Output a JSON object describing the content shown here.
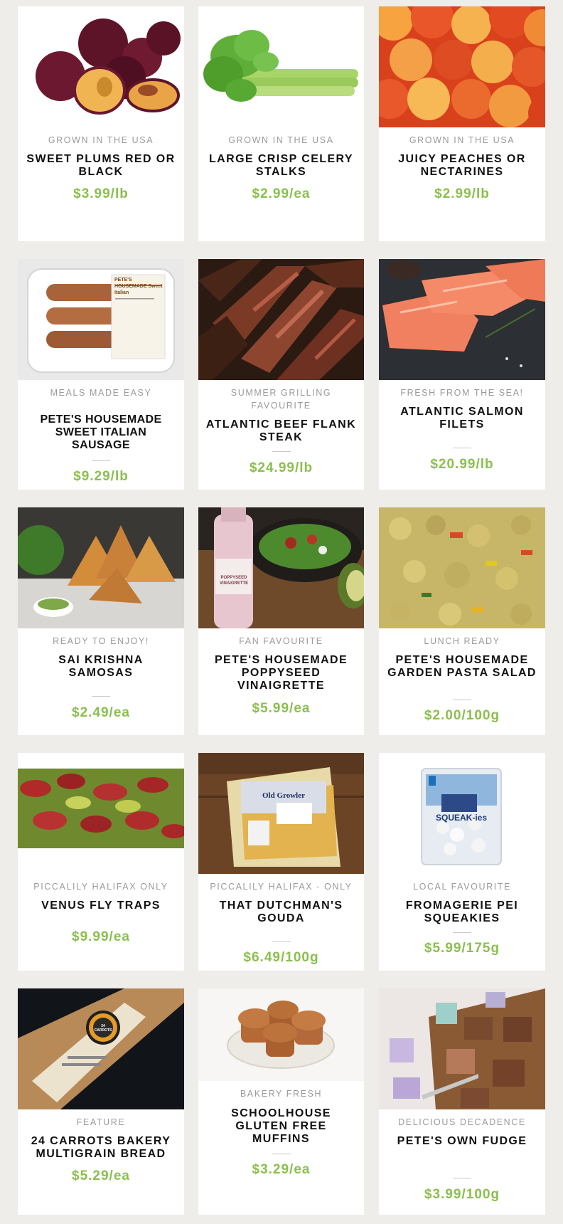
{
  "colors": {
    "background": "#efedea",
    "card": "#ffffff",
    "price": "#8bbf4d",
    "tag": "#9a9a9a",
    "title": "#111111"
  },
  "products": [
    {
      "image": "plums-photo",
      "tag": "GROWN IN THE USA",
      "title": "SWEET PLUMS RED OR BLACK",
      "price": "$3.99/lb"
    },
    {
      "image": "celery-photo",
      "tag": "GROWN IN THE USA",
      "title": "LARGE CRISP CELERY STALKS",
      "price": "$2.99/ea"
    },
    {
      "image": "peaches-photo",
      "tag": "GROWN IN THE USA",
      "title": "JUICY PEACHES OR NECTARINES",
      "price": "$2.99/lb"
    },
    {
      "image": "sausage-photo",
      "tag": "MEALS MADE EASY",
      "title": "PETE'S HOUSEMADE SWEET ITALIAN SAUSAGE",
      "price": "$9.29/lb",
      "packaging_text": "PETE'S HOUSEMADE Sweet Italian"
    },
    {
      "image": "flank-steak-photo",
      "tag": "SUMMER GRILLING FAVOURITE",
      "title": "ATLANTIC BEEF FLANK STEAK",
      "price": "$24.99/lb"
    },
    {
      "image": "salmon-photo",
      "tag": "FRESH FROM THE SEA!",
      "title": "ATLANTIC SALMON FILETS",
      "price": "$20.99/lb"
    },
    {
      "image": "samosas-photo",
      "tag": "READY TO ENJOY!",
      "title": "SAI KRISHNA SAMOSAS",
      "price": "$2.49/ea"
    },
    {
      "image": "vinaigrette-photo",
      "tag": "FAN FAVOURITE",
      "title": "PETE'S HOUSEMADE POPPYSEED VINAIGRETTE",
      "price": "$5.99/ea",
      "packaging_text": "POPPYSEED VINAIGRETTE"
    },
    {
      "image": "pasta-salad-photo",
      "tag": "LUNCH READY",
      "title": "PETE'S HOUSEMADE GARDEN PASTA SALAD",
      "price": "$2.00/100g"
    },
    {
      "image": "venus-fly-traps-photo",
      "tag": "PICCALILY HALIFAX ONLY",
      "title": "VENUS FLY TRAPS",
      "price": "$9.99/ea"
    },
    {
      "image": "gouda-photo",
      "tag": "PICCALILY HALIFAX - ONLY",
      "title": "THAT DUTCHMAN'S GOUDA",
      "price": "$6.49/100g",
      "packaging_text": "Old Growler"
    },
    {
      "image": "cheese-curds-photo",
      "tag": "LOCAL FAVOURITE",
      "title": "FROMAGERIE PEI SQUEAKIES",
      "price": "$5.99/175g",
      "packaging_text": "SQUEAK-ies"
    },
    {
      "image": "bread-photo",
      "tag": "FEATURE",
      "title": "24 CARROTS BAKERY MULTIGRAIN BREAD",
      "price": "$5.29/ea",
      "packaging_text": "24 CARROTS"
    },
    {
      "image": "muffins-photo",
      "tag": "BAKERY FRESH",
      "title": "SCHOOLHOUSE GLUTEN FREE MUFFINS",
      "price": "$3.29/ea"
    },
    {
      "image": "fudge-photo",
      "tag": "DELICIOUS DECADENCE",
      "title": "PETE'S OWN FUDGE",
      "price": "$3.99/100g"
    }
  ]
}
